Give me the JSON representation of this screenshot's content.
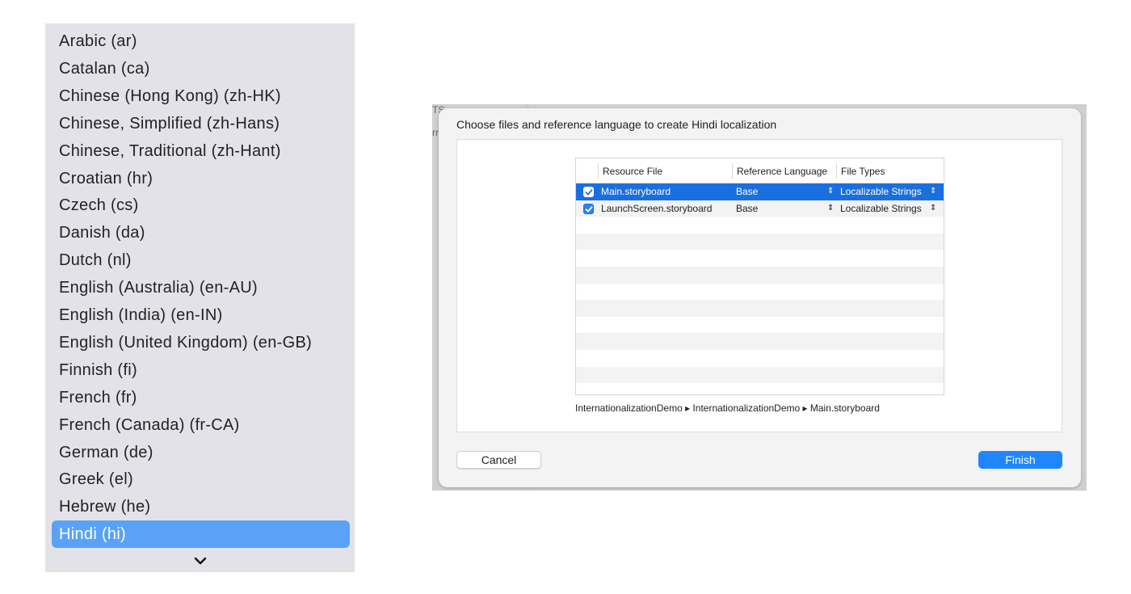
{
  "language_menu": {
    "items": [
      {
        "label": "Arabic (ar)"
      },
      {
        "label": "Catalan (ca)"
      },
      {
        "label": "Chinese (Hong Kong) (zh-HK)"
      },
      {
        "label": "Chinese, Simplified (zh-Hans)"
      },
      {
        "label": "Chinese, Traditional (zh-Hant)"
      },
      {
        "label": "Croatian (hr)"
      },
      {
        "label": "Czech (cs)"
      },
      {
        "label": "Danish (da)"
      },
      {
        "label": "Dutch (nl)"
      },
      {
        "label": "English (Australia) (en-AU)"
      },
      {
        "label": "English (India) (en-IN)"
      },
      {
        "label": "English (United Kingdom) (en-GB)"
      },
      {
        "label": "Finnish (fi)"
      },
      {
        "label": "French (fr)"
      },
      {
        "label": "French (Canada) (fr-CA)"
      },
      {
        "label": "German (de)"
      },
      {
        "label": "Greek (el)"
      },
      {
        "label": "Hebrew (he)"
      },
      {
        "label": "Hindi (hi)"
      }
    ],
    "selected_label": "Hindi (hi)",
    "scroll_icon": "chevron-down-icon"
  },
  "backdrop": {
    "fragment_1": "TS",
    "fragment_2": "rr"
  },
  "dialog": {
    "title": "Choose files and reference language to create Hindi localization",
    "table": {
      "columns": [
        "Resource File",
        "Reference Language",
        "File Types"
      ],
      "rows": [
        {
          "checked": true,
          "file": "Main.storyboard",
          "language": "Base",
          "type": "Localizable Strings",
          "selected": true
        },
        {
          "checked": true,
          "file": "LaunchScreen.storyboard",
          "language": "Base",
          "type": "Localizable Strings",
          "selected": false
        }
      ],
      "stepper_glyph": "⌃⌄"
    },
    "path": "InternationalizationDemo ▸ InternationalizationDemo ▸ Main.storyboard",
    "cancel_label": "Cancel",
    "finish_label": "Finish"
  },
  "colors": {
    "menu_background": "#e3e2e9",
    "menu_selection": "#5aa2f7",
    "row_selection": "#1a6fe0",
    "primary_button": "#1f86ff"
  }
}
